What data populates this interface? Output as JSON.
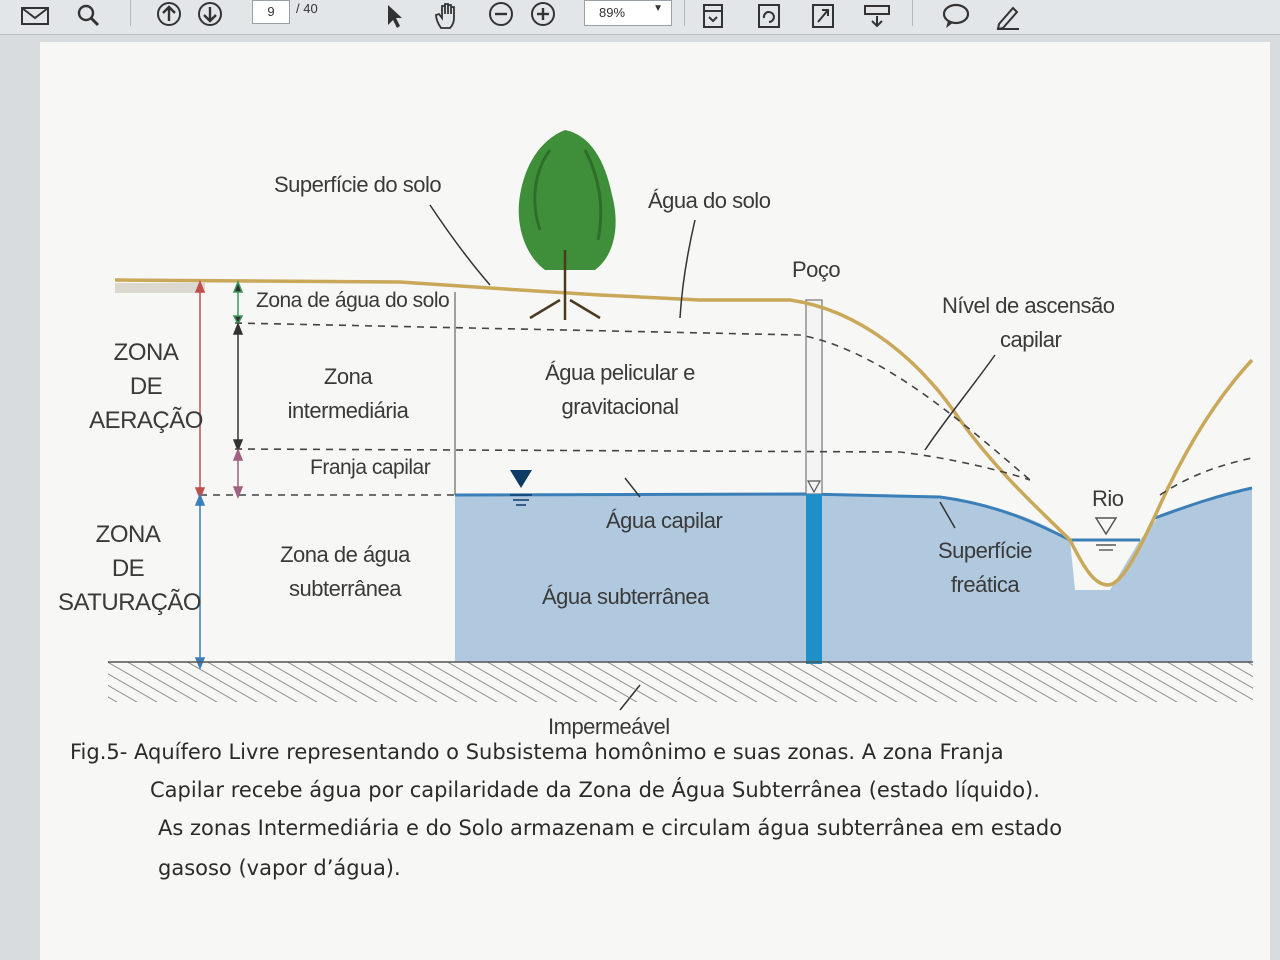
{
  "toolbar": {
    "icons": [
      "mail-icon",
      "search-icon",
      "page-up-icon",
      "page-down-icon",
      "select-arrow-icon",
      "hand-tool-icon",
      "zoom-out-icon",
      "zoom-in-icon",
      "fit-page-icon",
      "rotate-icon",
      "fullscreen-icon",
      "tools-icon",
      "comment-icon",
      "sign-pen-icon"
    ],
    "page_current": "9",
    "page_total": "/ 40",
    "zoom": "89%"
  },
  "diagram": {
    "superficie_solo": "Superfície do solo",
    "agua_do_solo": "Água do solo",
    "poco": "Poço",
    "nivel_l1": "Nível de ascensão",
    "nivel_l2": "capilar",
    "zona_agua_solo": "Zona de água do solo",
    "zona_aeracao": [
      "ZONA",
      "DE",
      "AERAÇÃO"
    ],
    "zona_intermediaria": [
      "Zona",
      "intermediária"
    ],
    "agua_pelicular": [
      "Água pelicular e",
      "gravitacional"
    ],
    "franja_capilar": "Franja capilar",
    "agua_capilar": "Água capilar",
    "rio": "Rio",
    "zona_saturacao": [
      "ZONA",
      "DE",
      "SATURAÇÃO"
    ],
    "zona_subterranea": [
      "Zona de água",
      "subterrânea"
    ],
    "agua_subterranea": "Água subterrânea",
    "superficie_freatica": [
      "Superfície",
      "freática"
    ],
    "impermeavel": "Impermeável"
  },
  "caption": [
    "Fig.5- Aquífero Livre representando o Subsistema homônimo e suas zonas. A zona Franja",
    "Capilar recebe água por capilaridade da Zona de Água Subterrânea  (estado  líquido).",
    "As zonas Intermediária e do Solo armazenam e circulam água subterrânea em estado",
    "gasoso  (vapor d’água)."
  ],
  "colors": {
    "water": "#a9c3dc",
    "water_line": "#3b7fb8",
    "soil_line": "#c9a85a",
    "well": "#1f8fc8",
    "toolbar_bg": "#e3e6e9"
  }
}
